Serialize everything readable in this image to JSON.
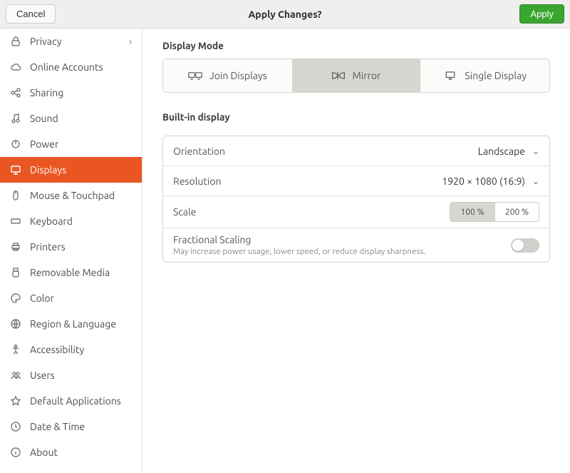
{
  "titlebar": {
    "cancel_label": "Cancel",
    "title": "Apply Changes?",
    "apply_label": "Apply"
  },
  "sidebar": {
    "items": [
      {
        "icon": "lock-icon",
        "label": "Privacy",
        "has_chevron": true
      },
      {
        "icon": "cloud-icon",
        "label": "Online Accounts"
      },
      {
        "icon": "share-icon",
        "label": "Sharing"
      },
      {
        "icon": "music-icon",
        "label": "Sound"
      },
      {
        "icon": "power-icon",
        "label": "Power"
      },
      {
        "icon": "displays-icon",
        "label": "Displays",
        "active": true
      },
      {
        "icon": "mouse-icon",
        "label": "Mouse & Touchpad"
      },
      {
        "icon": "keyboard-icon",
        "label": "Keyboard"
      },
      {
        "icon": "printer-icon",
        "label": "Printers"
      },
      {
        "icon": "usb-icon",
        "label": "Removable Media"
      },
      {
        "icon": "color-icon",
        "label": "Color"
      },
      {
        "icon": "globe-icon",
        "label": "Region & Language"
      },
      {
        "icon": "accessibility-icon",
        "label": "Accessibility"
      },
      {
        "icon": "users-icon",
        "label": "Users"
      },
      {
        "icon": "star-icon",
        "label": "Default Applications"
      },
      {
        "icon": "clock-icon",
        "label": "Date & Time"
      },
      {
        "icon": "info-icon",
        "label": "About"
      }
    ]
  },
  "display_mode": {
    "section_label": "Display Mode",
    "options": {
      "join_label": "Join Displays",
      "mirror_label": "Mirror",
      "single_label": "Single Display"
    },
    "selected": "mirror"
  },
  "builtin": {
    "section_label": "Built-in display",
    "orientation": {
      "label": "Orientation",
      "value": "Landscape"
    },
    "resolution": {
      "label": "Resolution",
      "value": "1920 × 1080 (16:9)"
    },
    "scale": {
      "label": "Scale",
      "options": {
        "s100": "100 %",
        "s200": "200 %"
      },
      "selected": "100 %"
    },
    "fractional": {
      "label": "Fractional Scaling",
      "sublabel": "May increase power usage, lower speed, or reduce display sharpness.",
      "enabled": false
    }
  }
}
